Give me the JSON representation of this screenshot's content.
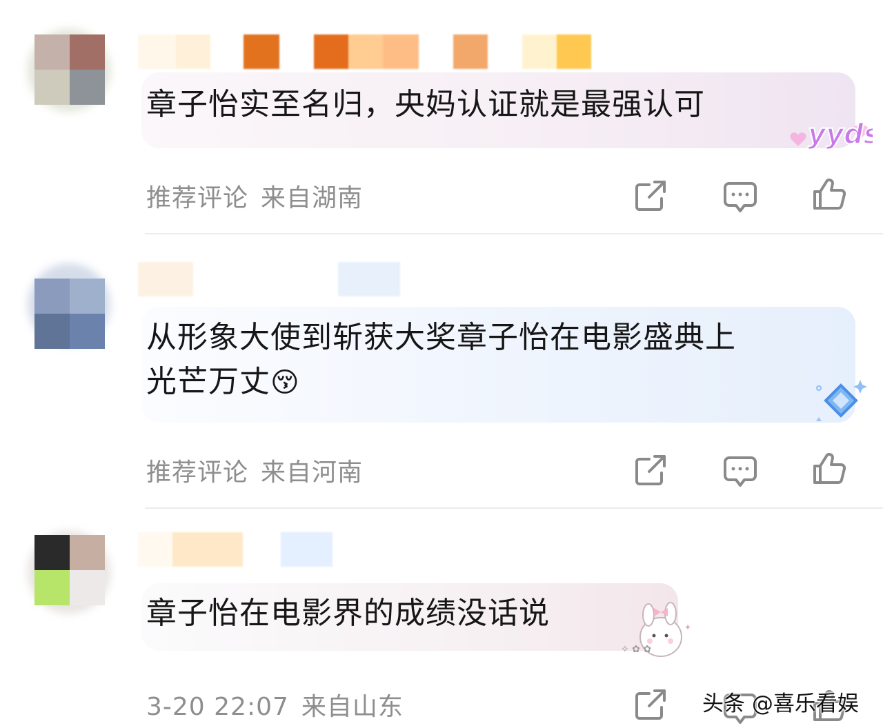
{
  "comments": [
    {
      "text": "章子怡实至名归，央妈认证就是最强认可",
      "label": "推荐评论",
      "location": "来自湖南",
      "badge": "yyds"
    },
    {
      "text": "从形象大使到斩获大奖章子怡在电影盛典上\n光芒万丈",
      "emoji": "😚",
      "label": "推荐评论",
      "location": "来自河南"
    },
    {
      "text": "章子怡在电影界的成绩没话说",
      "time": "3-20 22:07",
      "location": "来自山东"
    }
  ],
  "icons": [
    "share-icon",
    "comment-icon",
    "like-icon"
  ],
  "watermark": "头条 @喜乐看娱",
  "colors": {
    "meta_text": "#8e8e8e",
    "icon_stroke": "#8a8a8a",
    "bubble_pink": "#f7ecf3",
    "bubble_blue": "#eaf3fd",
    "badge_purple": "#b36be0"
  }
}
